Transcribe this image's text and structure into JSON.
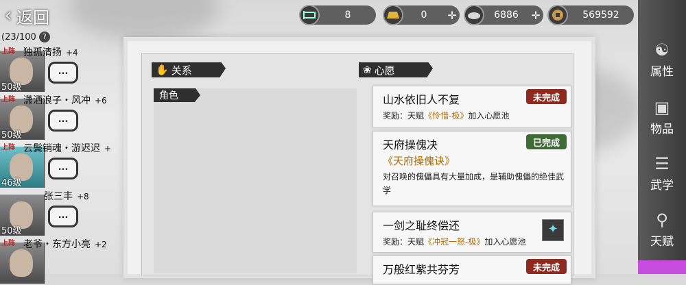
{
  "top": {
    "back_label": "返回",
    "resources": [
      {
        "icon": "bed-icon",
        "value": "8",
        "plus": ""
      },
      {
        "icon": "gold-bar-icon",
        "value": "0",
        "plus": "✛"
      },
      {
        "icon": "silver-ingot-icon",
        "value": "6886",
        "plus": "✛"
      },
      {
        "icon": "coin-icon",
        "value": "569592",
        "plus": "✛"
      }
    ]
  },
  "roster": {
    "count": "(23/100",
    "help": "?",
    "members": [
      {
        "tag": "上阵",
        "name": "独孤清扬",
        "bonus": "+4",
        "level": "50级",
        "chat": "..."
      },
      {
        "tag": "上阵",
        "name": "潇洒浪子・风冲",
        "bonus": "+6",
        "level": "50级",
        "chat": "..."
      },
      {
        "tag": "上阵",
        "name": "云鬓销魂・游迟迟",
        "bonus": "+",
        "level": "46级",
        "chat": "..."
      },
      {
        "tag": "",
        "name": "张三丰",
        "bonus": "+8",
        "level": "50级",
        "chat": "..."
      },
      {
        "tag": "上阵",
        "name": "老爷・东方小亮",
        "bonus": "+2",
        "level": "",
        "chat": "..."
      }
    ]
  },
  "relations": {
    "title": "关系",
    "role_label": "角色"
  },
  "wishes": {
    "title": "心愿",
    "items": [
      {
        "title": "山水依旧人不复",
        "reward_prefix": "奖励：天赋",
        "reward_item": "《怜惜-极》",
        "reward_suffix": "加入心愿池",
        "status": "未完成"
      },
      {
        "title": "天府操傀决",
        "book": "《天府操傀诀》",
        "desc": "对召唤的傀儡具有大量加成，是辅助傀儡的绝佳武学",
        "status": "已完成"
      },
      {
        "title": "一剑之耻终偿还",
        "reward_prefix": "奖励：天赋",
        "reward_item": "《冲冠一怒-极》",
        "reward_suffix": "加入心愿池",
        "status": ""
      },
      {
        "title": "万般红紫共芬芳",
        "status": "未完成"
      }
    ]
  },
  "tabs": [
    {
      "icon": "attributes-icon",
      "label": "属性"
    },
    {
      "icon": "items-icon",
      "label": "物品"
    },
    {
      "icon": "martial-arts-icon",
      "label": "武学"
    },
    {
      "icon": "talent-icon",
      "label": "天赋"
    }
  ],
  "colors": {
    "accent_tab": "#c84be0",
    "incomplete": "#8e2a1f",
    "complete": "#3e6b35",
    "reward_gold": "#b06d00"
  }
}
